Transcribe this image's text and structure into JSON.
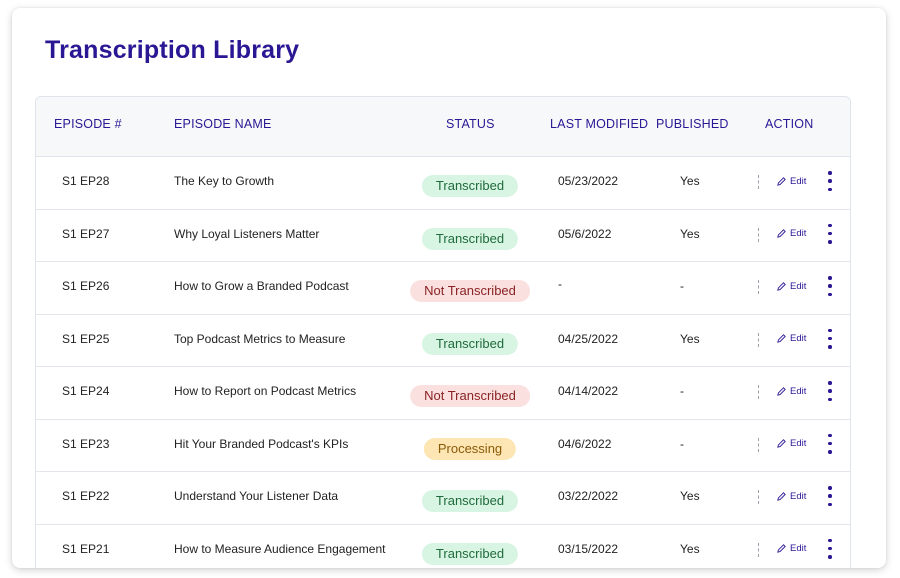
{
  "page": {
    "title": "Transcription Library"
  },
  "table": {
    "headers": {
      "episode": "EPISODE #",
      "name": "EPISODE NAME",
      "status": "STATUS",
      "modified": "LAST MODIFIED",
      "published": "PUBLISHED",
      "action": "ACTION"
    },
    "edit_label": "Edit",
    "rows": [
      {
        "episode": "S1 EP28",
        "name": "The Key to Growth",
        "status": "Transcribed",
        "status_type": "transcribed",
        "modified": "05/23/2022",
        "published": "Yes"
      },
      {
        "episode": "S1 EP27",
        "name": "Why Loyal Listeners Matter",
        "status": "Transcribed",
        "status_type": "transcribed",
        "modified": "05/6/2022",
        "published": "Yes"
      },
      {
        "episode": "S1 EP26",
        "name": "How to Grow a Branded Podcast",
        "status": "Not Transcribed",
        "status_type": "not",
        "modified": "-",
        "published": "-"
      },
      {
        "episode": "S1 EP25",
        "name": "Top Podcast Metrics to Measure",
        "status": "Transcribed",
        "status_type": "transcribed",
        "modified": "04/25/2022",
        "published": "Yes"
      },
      {
        "episode": "S1 EP24",
        "name": "How to Report on Podcast Metrics",
        "status": "Not Transcribed",
        "status_type": "not",
        "modified": "04/14/2022",
        "published": "-"
      },
      {
        "episode": "S1 EP23",
        "name": "Hit Your Branded Podcast's KPIs",
        "status": "Processing",
        "status_type": "processing",
        "modified": "04/6/2022",
        "published": "-"
      },
      {
        "episode": "S1 EP22",
        "name": "Understand Your Listener Data",
        "status": "Transcribed",
        "status_type": "transcribed",
        "modified": "03/22/2022",
        "published": "Yes"
      },
      {
        "episode": "S1 EP21",
        "name": "How to Measure Audience Engagement",
        "status": "Transcribed",
        "status_type": "transcribed",
        "modified": "03/15/2022",
        "published": "Yes"
      }
    ]
  },
  "colors": {
    "accent": "#2a1794",
    "transcribed_bg": "#d8f5e3",
    "not_transcribed_bg": "#fbe0e0",
    "processing_bg": "#fde6b4"
  },
  "icons": {
    "edit": "pencil-icon",
    "more": "more-vertical-icon"
  }
}
